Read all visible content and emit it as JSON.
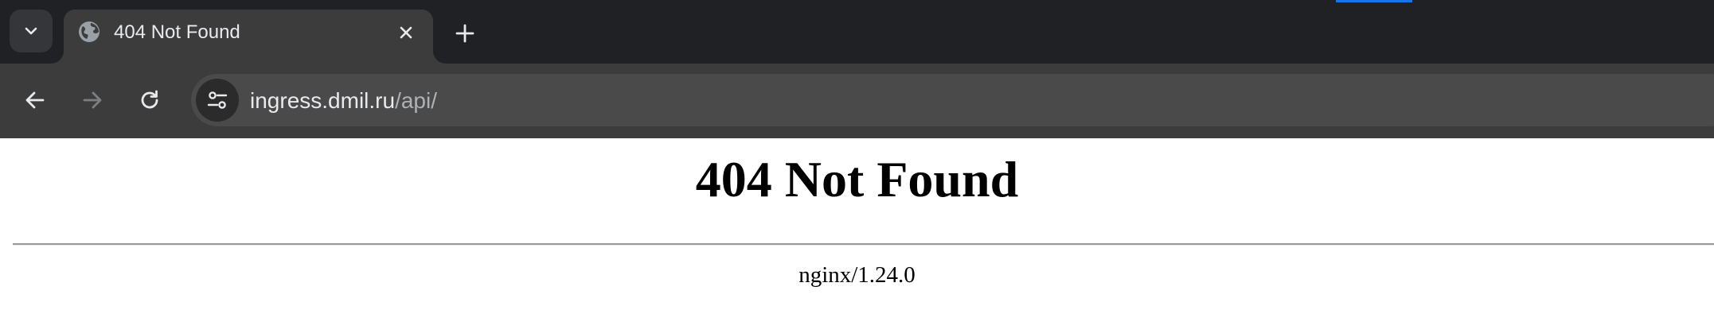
{
  "browser": {
    "tab": {
      "title": "404 Not Found",
      "favicon": "globe-icon",
      "close_icon": "close-icon"
    },
    "tab_search_icon": "chevron-down-icon",
    "new_tab_icon": "plus-icon",
    "toolbar": {
      "back_icon": "arrow-left-icon",
      "forward_icon": "arrow-right-icon",
      "reload_icon": "reload-icon",
      "site_info_icon": "tune-icon"
    },
    "address_bar": {
      "host": "ingress.dmil.ru",
      "path": "/api/"
    },
    "colors": {
      "tabstrip_bg": "#202124",
      "toolbar_bg": "#3c3c3c",
      "omnibox_bg": "#4a4a4a",
      "text_primary": "#e8eaed",
      "text_secondary": "#aeb1b5"
    }
  },
  "page": {
    "heading": "404 Not Found",
    "server_info": "nginx/1.24.0"
  }
}
